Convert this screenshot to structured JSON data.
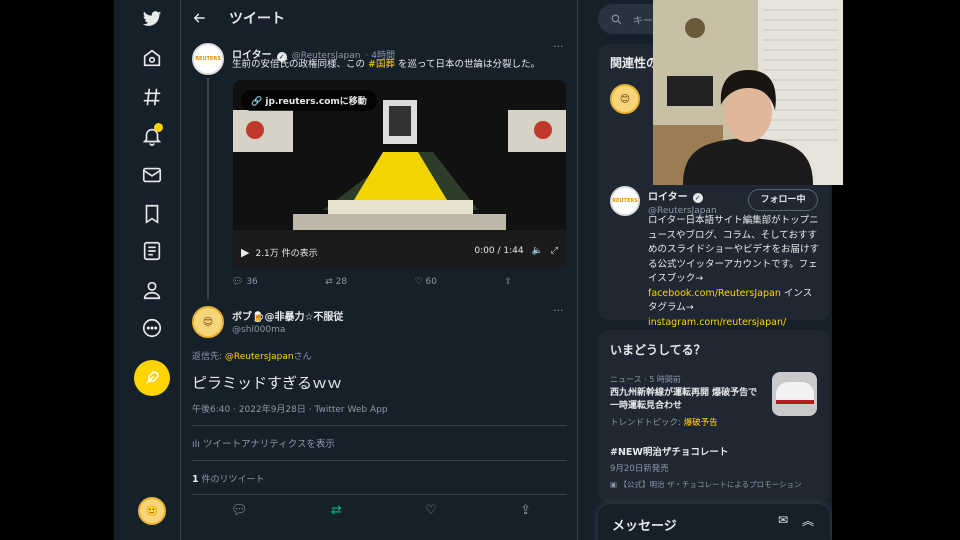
{
  "header": {
    "title": "ツイート"
  },
  "original_tweet": {
    "author_name": "ロイター",
    "handle": "@ReutersJapan",
    "time": "· 4時間",
    "text_before": "生前の安倍氏の政権同様、この ",
    "hashtag": "#国葬",
    "text_after": " を巡って日本の世論は分裂した。",
    "link_label": "jp.reuters.comに移動",
    "views": "2.1万 件の表示",
    "video_time": "0:00 / 1:44",
    "replies": "36",
    "retweets": "28",
    "likes": "60",
    "avatar_text": "REUTERS"
  },
  "reply_tweet": {
    "author_name": "ボブ🍺@非暴力☆不服従",
    "handle": "@shi000ma",
    "reply_to_prefix": "返信先: ",
    "reply_to_handle": "@ReutersJapan",
    "reply_to_suffix": "さん",
    "text": "ピラミッドすぎるｗｗ",
    "meta": "午後6:40 · 2022年9月28日 · Twitter Web App",
    "analytics": "ツイートアナリティクスを表示",
    "retweet_count": "1",
    "retweet_label": " 件のリツイート"
  },
  "search": {
    "placeholder": "キー"
  },
  "related": {
    "title": "関連性の",
    "account_name": "ロイター",
    "account_handle": "@ReutersJapan",
    "follow_label": "フォロー中",
    "bio_1": "ロイター日本語サイト編集部がトップニュースやブログ、コラム、そしておすすめのスライドショーやビデオをお届けする公式ツイッターアカウントです。フェイスブック→ ",
    "bio_link1": "facebook.com/ReutersJapan",
    "bio_2": " インスタグラム→ ",
    "bio_link2": "instagram.com/reutersjapan/"
  },
  "trends": {
    "title": "いまどうしてる？",
    "item1_meta": "ニュース · 5 時間前",
    "item1_text": "西九州新幹線が運転再開 爆破予告で一時運転見合わせ",
    "item1_topic_prefix": "トレンドトピック: ",
    "item1_topic": "爆破予告",
    "item2_title": "#NEW明治ザチョコレート",
    "item2_sub": "9月20日新発売",
    "item2_promo": "【公式】明治 ザ・チョコレートによるプロモーション"
  },
  "messages": {
    "title": "メッセージ"
  },
  "colors": {
    "accent": "#ffd400",
    "bg": "#15202b",
    "card": "#1e2732"
  }
}
